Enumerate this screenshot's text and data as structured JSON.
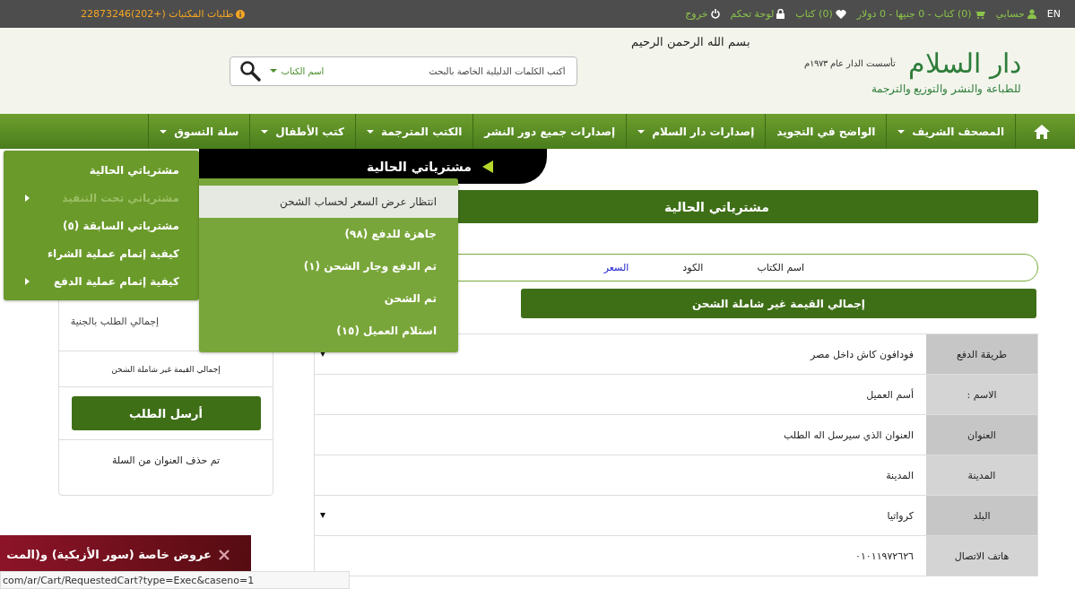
{
  "top_bar": {
    "language": "EN",
    "account": "حسابي",
    "cart": "(0) كتاب - 0 جنيها - 0 دولار",
    "wishlist": "(0) كتاب",
    "dashboard": "لوحة تحكم",
    "logout": "خروج",
    "library_orders": "طلبات المكتبات (+202)22873246"
  },
  "header": {
    "logo_title": "دار السلام",
    "logo_founded": "تأسست الدار عام ١٩٧٣م",
    "logo_subtitle": "للطباعة والنشر والتوزيع والترجمة",
    "basmala": "بسم الله الرحمن الرحيم",
    "search": {
      "placeholder": "أكتب الكلمات الدليلية الخاصة بالبحث",
      "scope": "اسم الكتاب"
    }
  },
  "nav": [
    {
      "label": "المصحف الشريف",
      "has_dropdown": true
    },
    {
      "label": "الواضح في التجويد",
      "has_dropdown": false
    },
    {
      "label": "إصدارات دار السلام",
      "has_dropdown": true
    },
    {
      "label": "إصدارات جميع دور النشر",
      "has_dropdown": false
    },
    {
      "label": "الكتب المترجمة",
      "has_dropdown": true
    },
    {
      "label": "كتب الأطفال",
      "has_dropdown": true
    },
    {
      "label": "سلة التسوق",
      "has_dropdown": true
    }
  ],
  "breadcrumb": "مشترياتي الحالية",
  "cart_menu": [
    {
      "label": "مشترياتي الحالية",
      "has_submenu": false,
      "expanded": false
    },
    {
      "label": "مشترياتي تحت التنفيذ",
      "has_submenu": true,
      "expanded": true
    },
    {
      "label": "مشترياتي السابقة (٥)",
      "has_submenu": false,
      "expanded": false
    },
    {
      "label": "كيفية إتمام عملية الشراء",
      "has_submenu": false,
      "expanded": false
    },
    {
      "label": "كيفية إتمام عملية الدفع",
      "has_submenu": true,
      "expanded": false
    }
  ],
  "submenu": [
    {
      "label": "انتظار عرض السعر لحساب الشحن",
      "selected": true
    },
    {
      "label": "جاهزة للدفع (٩٨)",
      "selected": false
    },
    {
      "label": "تم الدفع وجار الشحن (١)",
      "selected": false
    },
    {
      "label": "تم الشحن",
      "selected": false
    },
    {
      "label": "استلام العميل (١٥)",
      "selected": false
    }
  ],
  "page_title": "مشترياتي الحالية",
  "table": {
    "columns": [
      {
        "label": "اسم الكتاب",
        "link": false
      },
      {
        "label": "الكود",
        "link": false
      },
      {
        "label": "السعر",
        "link": true
      }
    ]
  },
  "total_bar": "إجمالي القيمة غير شاملة الشحن",
  "order_details": [
    {
      "label": "طريقة الدفع",
      "value": "فودافون كاش داخل مصر",
      "kind": "select"
    },
    {
      "label": "الاسم :",
      "value": "أسم العميل",
      "kind": "text"
    },
    {
      "label": "العنوان",
      "value": "العنوان الذي سيرسل اله الطلب",
      "kind": "text"
    },
    {
      "label": "المدينة",
      "value": "المدينة",
      "kind": "text"
    },
    {
      "label": "البلد",
      "value": "كرواتيا",
      "kind": "select"
    },
    {
      "label": "هاتف الاتصال",
      "value": "٠١٠١١٩٧٢٦٢٦",
      "kind": "text"
    }
  ],
  "summary": {
    "total_label": "إجمالي الطلب بالجنية",
    "total_note": "إجمالي القيمة غير شاملة الشحن",
    "submit": "أرسل الطلب",
    "message": "تم حذف العنوان من السلة"
  },
  "promo": "عروض خاصة (سور الأزبكية) و(المت",
  "status_url": "com/ar/Cart/RequestedCart?type=Exec&caseno=1"
}
